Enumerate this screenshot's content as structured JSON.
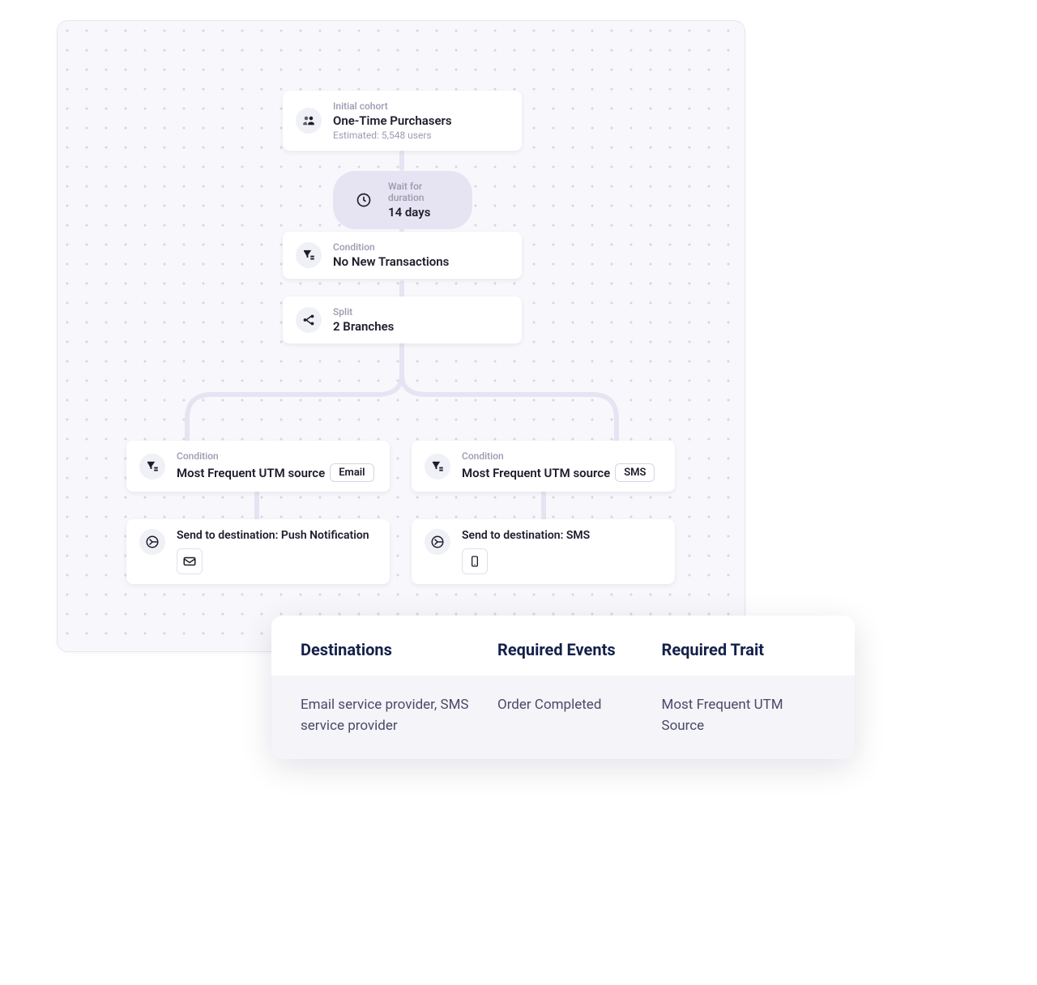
{
  "cohort": {
    "label": "Initial cohort",
    "title": "One-Time Purchasers",
    "estimate": "Estimated: 5,548 users"
  },
  "wait": {
    "label": "Wait for duration",
    "value": "14 days"
  },
  "condition1": {
    "label": "Condition",
    "title": "No New Transactions"
  },
  "split": {
    "label": "Split",
    "title": "2 Branches"
  },
  "branchLeft": {
    "conditionLabel": "Condition",
    "conditionTitle": "Most Frequent UTM source",
    "pill": "Email",
    "sendLabel": "Send to destination: Push Notification"
  },
  "branchRight": {
    "conditionLabel": "Condition",
    "conditionTitle": "Most Frequent UTM source",
    "pill": "SMS",
    "sendLabel": "Send to destination: SMS"
  },
  "table": {
    "headers": {
      "destinations": "Destinations",
      "events": "Required Events",
      "trait": "Required Trait"
    },
    "row": {
      "destinations": "Email service provider, SMS service provider",
      "events": "Order Completed",
      "trait": "Most Frequent UTM Source"
    }
  }
}
